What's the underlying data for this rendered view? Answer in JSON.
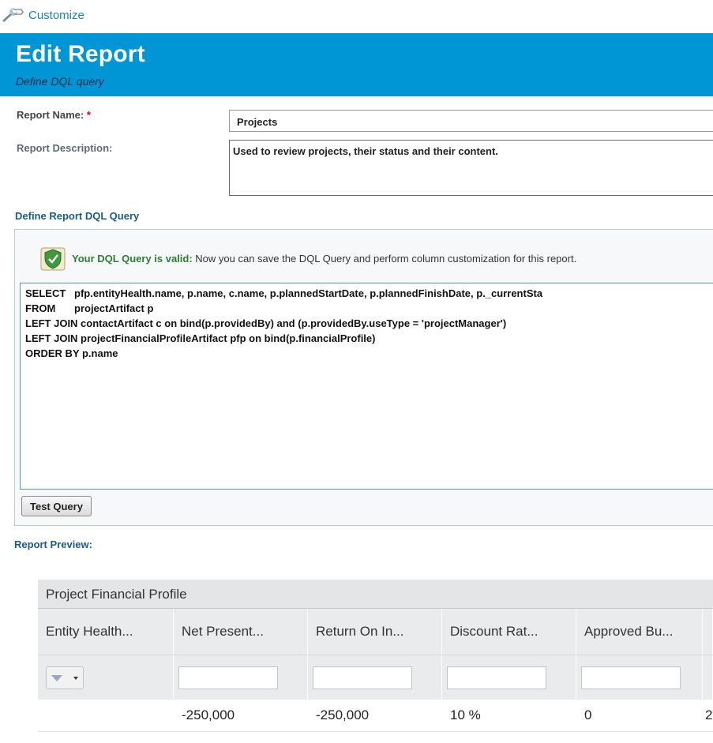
{
  "customize": {
    "label": "Customize",
    "icon": "wrench-icon"
  },
  "header": {
    "title": "Edit Report",
    "subtitle": "Define DQL query"
  },
  "form": {
    "name_label": "Report Name:",
    "required_mark": "*",
    "name_value": "Projects",
    "description_label": "Report Description:",
    "description_value": "Used to review projects, their status and their content."
  },
  "dql": {
    "section_label": "Define Report DQL Query",
    "valid_bold": "Your DQL Query is valid:",
    "valid_rest": " Now you can save the DQL Query and perform column customization for this report.",
    "lines": [
      {
        "kw": "SELECT",
        "text": "pfp.entityHealth.name, p.name, c.name, p.plannedStartDate, p.plannedFinishDate, p._currentSta"
      },
      {
        "kw": "FROM",
        "text": "projectArtifact p"
      },
      {
        "kw": "",
        "text": "LEFT JOIN contactArtifact c on bind(p.providedBy) and (p.providedBy.useType = 'projectManager')"
      },
      {
        "kw": "",
        "text": "LEFT JOIN projectFinancialProfileArtifact pfp on bind(p.financialProfile)"
      },
      {
        "kw": "",
        "text": "ORDER BY p.name"
      }
    ],
    "test_button": "Test Query"
  },
  "preview": {
    "label": "Report Preview:",
    "group_header": "Project Financial Profile",
    "columns": [
      "Entity Health...",
      "Net Present...",
      "Return On In...",
      "Discount Rat...",
      "Approved Bu...",
      ""
    ],
    "row": [
      "",
      "-250,000",
      "-250,000",
      "10 %",
      "0",
      "2"
    ]
  },
  "colors": {
    "header_bg": "#0096d6",
    "link": "#1b7fb9",
    "valid_text": "#2e7d32",
    "required": "#d40000"
  }
}
